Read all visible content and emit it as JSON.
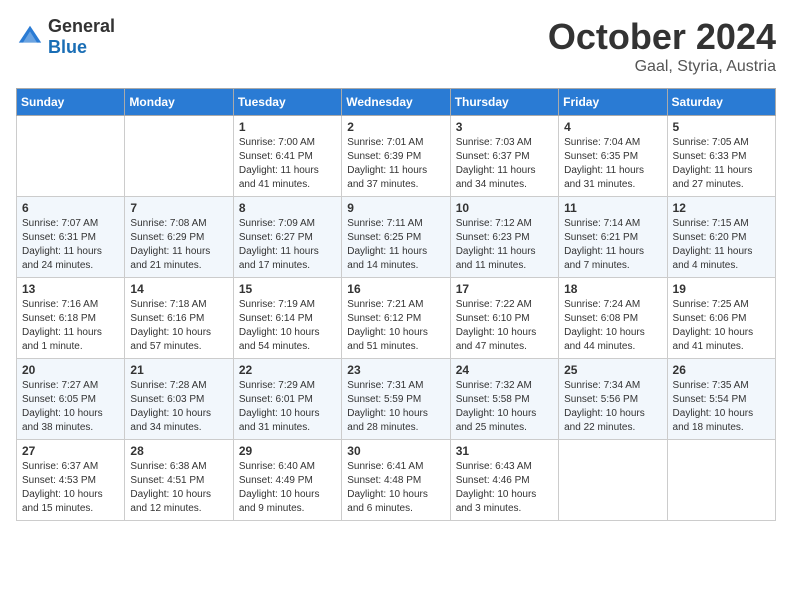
{
  "logo": {
    "general": "General",
    "blue": "Blue"
  },
  "title": "October 2024",
  "subtitle": "Gaal, Styria, Austria",
  "days_of_week": [
    "Sunday",
    "Monday",
    "Tuesday",
    "Wednesday",
    "Thursday",
    "Friday",
    "Saturday"
  ],
  "weeks": [
    [
      {
        "day": "",
        "info": ""
      },
      {
        "day": "",
        "info": ""
      },
      {
        "day": "1",
        "info": "Sunrise: 7:00 AM\nSunset: 6:41 PM\nDaylight: 11 hours and 41 minutes."
      },
      {
        "day": "2",
        "info": "Sunrise: 7:01 AM\nSunset: 6:39 PM\nDaylight: 11 hours and 37 minutes."
      },
      {
        "day": "3",
        "info": "Sunrise: 7:03 AM\nSunset: 6:37 PM\nDaylight: 11 hours and 34 minutes."
      },
      {
        "day": "4",
        "info": "Sunrise: 7:04 AM\nSunset: 6:35 PM\nDaylight: 11 hours and 31 minutes."
      },
      {
        "day": "5",
        "info": "Sunrise: 7:05 AM\nSunset: 6:33 PM\nDaylight: 11 hours and 27 minutes."
      }
    ],
    [
      {
        "day": "6",
        "info": "Sunrise: 7:07 AM\nSunset: 6:31 PM\nDaylight: 11 hours and 24 minutes."
      },
      {
        "day": "7",
        "info": "Sunrise: 7:08 AM\nSunset: 6:29 PM\nDaylight: 11 hours and 21 minutes."
      },
      {
        "day": "8",
        "info": "Sunrise: 7:09 AM\nSunset: 6:27 PM\nDaylight: 11 hours and 17 minutes."
      },
      {
        "day": "9",
        "info": "Sunrise: 7:11 AM\nSunset: 6:25 PM\nDaylight: 11 hours and 14 minutes."
      },
      {
        "day": "10",
        "info": "Sunrise: 7:12 AM\nSunset: 6:23 PM\nDaylight: 11 hours and 11 minutes."
      },
      {
        "day": "11",
        "info": "Sunrise: 7:14 AM\nSunset: 6:21 PM\nDaylight: 11 hours and 7 minutes."
      },
      {
        "day": "12",
        "info": "Sunrise: 7:15 AM\nSunset: 6:20 PM\nDaylight: 11 hours and 4 minutes."
      }
    ],
    [
      {
        "day": "13",
        "info": "Sunrise: 7:16 AM\nSunset: 6:18 PM\nDaylight: 11 hours and 1 minute."
      },
      {
        "day": "14",
        "info": "Sunrise: 7:18 AM\nSunset: 6:16 PM\nDaylight: 10 hours and 57 minutes."
      },
      {
        "day": "15",
        "info": "Sunrise: 7:19 AM\nSunset: 6:14 PM\nDaylight: 10 hours and 54 minutes."
      },
      {
        "day": "16",
        "info": "Sunrise: 7:21 AM\nSunset: 6:12 PM\nDaylight: 10 hours and 51 minutes."
      },
      {
        "day": "17",
        "info": "Sunrise: 7:22 AM\nSunset: 6:10 PM\nDaylight: 10 hours and 47 minutes."
      },
      {
        "day": "18",
        "info": "Sunrise: 7:24 AM\nSunset: 6:08 PM\nDaylight: 10 hours and 44 minutes."
      },
      {
        "day": "19",
        "info": "Sunrise: 7:25 AM\nSunset: 6:06 PM\nDaylight: 10 hours and 41 minutes."
      }
    ],
    [
      {
        "day": "20",
        "info": "Sunrise: 7:27 AM\nSunset: 6:05 PM\nDaylight: 10 hours and 38 minutes."
      },
      {
        "day": "21",
        "info": "Sunrise: 7:28 AM\nSunset: 6:03 PM\nDaylight: 10 hours and 34 minutes."
      },
      {
        "day": "22",
        "info": "Sunrise: 7:29 AM\nSunset: 6:01 PM\nDaylight: 10 hours and 31 minutes."
      },
      {
        "day": "23",
        "info": "Sunrise: 7:31 AM\nSunset: 5:59 PM\nDaylight: 10 hours and 28 minutes."
      },
      {
        "day": "24",
        "info": "Sunrise: 7:32 AM\nSunset: 5:58 PM\nDaylight: 10 hours and 25 minutes."
      },
      {
        "day": "25",
        "info": "Sunrise: 7:34 AM\nSunset: 5:56 PM\nDaylight: 10 hours and 22 minutes."
      },
      {
        "day": "26",
        "info": "Sunrise: 7:35 AM\nSunset: 5:54 PM\nDaylight: 10 hours and 18 minutes."
      }
    ],
    [
      {
        "day": "27",
        "info": "Sunrise: 6:37 AM\nSunset: 4:53 PM\nDaylight: 10 hours and 15 minutes."
      },
      {
        "day": "28",
        "info": "Sunrise: 6:38 AM\nSunset: 4:51 PM\nDaylight: 10 hours and 12 minutes."
      },
      {
        "day": "29",
        "info": "Sunrise: 6:40 AM\nSunset: 4:49 PM\nDaylight: 10 hours and 9 minutes."
      },
      {
        "day": "30",
        "info": "Sunrise: 6:41 AM\nSunset: 4:48 PM\nDaylight: 10 hours and 6 minutes."
      },
      {
        "day": "31",
        "info": "Sunrise: 6:43 AM\nSunset: 4:46 PM\nDaylight: 10 hours and 3 minutes."
      },
      {
        "day": "",
        "info": ""
      },
      {
        "day": "",
        "info": ""
      }
    ]
  ]
}
